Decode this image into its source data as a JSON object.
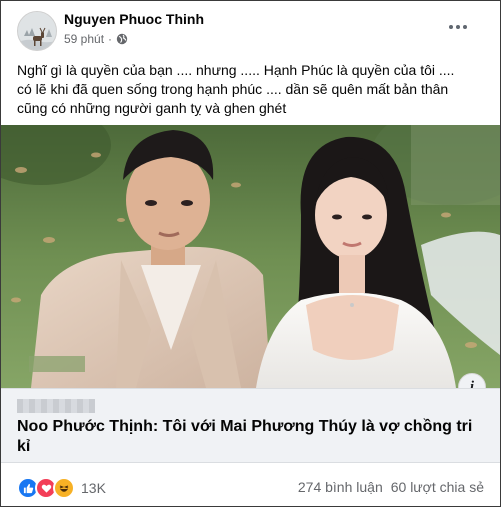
{
  "post": {
    "author": "Nguyen Phuoc Thinh",
    "time": "59 phút",
    "separator": "·",
    "caption_lines": [
      "Nghĩ gì là quyền của bạn .... nhưng ..... Hạnh Phúc là quyền của tôi ....",
      "có lẽ khi đã quen sống trong hạnh phúc .... dần sẽ quên mất bản thân",
      "cũng có những người ganh tỵ và ghen ghét"
    ]
  },
  "link_preview": {
    "title_lines": [
      "Noo Phước Thịnh: Tôi với Mai Phương Thúy là vợ chồng tri",
      "kỉ"
    ]
  },
  "info_button": "i",
  "footer": {
    "reaction_count": "13K",
    "comments": "274 bình luận",
    "shares": "60 lượt chia sẻ"
  },
  "colors": {
    "like": "#1877f2",
    "love": "#f33e58",
    "haha": "#f7b125",
    "secondary_text": "#65676b"
  },
  "icons": [
    "avatar-deer-icon",
    "globe-icon",
    "more-options-icon",
    "info-icon",
    "like-reaction-icon",
    "love-reaction-icon",
    "haha-reaction-icon"
  ]
}
